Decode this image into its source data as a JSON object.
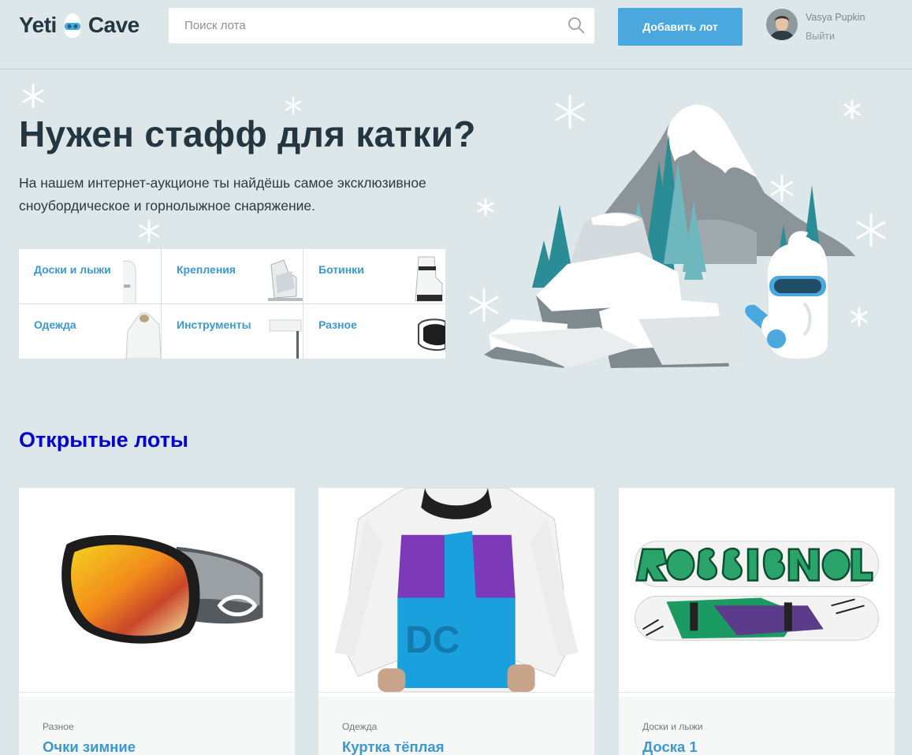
{
  "header": {
    "logo_left": "Yeti",
    "logo_right": "Cave",
    "search_placeholder": "Поиск лота",
    "add_lot_label": "Добавить лот",
    "user_name": "Vasya Pupkin",
    "logout_label": "Выйти"
  },
  "promo": {
    "title": "Нужен стафф для катки?",
    "text": "На нашем интернет-аукционе ты найдёшь самое эксклюзивное сноубордическое и горнолыжное снаряжение."
  },
  "categories": [
    {
      "label": "Доски и лыжи",
      "icon": "snowboard"
    },
    {
      "label": "Крепления",
      "icon": "binding"
    },
    {
      "label": "Ботинки",
      "icon": "boot"
    },
    {
      "label": "Одежда",
      "icon": "jacket"
    },
    {
      "label": "Инструменты",
      "icon": "tool"
    },
    {
      "label": "Разное",
      "icon": "goggles"
    }
  ],
  "lots": {
    "title": "Открытые лоты",
    "items": [
      {
        "category": "Разное",
        "name": "Очки зимние",
        "image": "goggles"
      },
      {
        "category": "Одежда",
        "name": "Куртка тёплая",
        "image": "jacket"
      },
      {
        "category": "Доски и лыжи",
        "name": "Доска 1",
        "image": "snowboard"
      }
    ]
  },
  "colors": {
    "background": "#dde6e8",
    "accent": "#4aa8de",
    "link": "#3c99d0",
    "heading": "#243641",
    "lots_title": "#0000d0"
  }
}
